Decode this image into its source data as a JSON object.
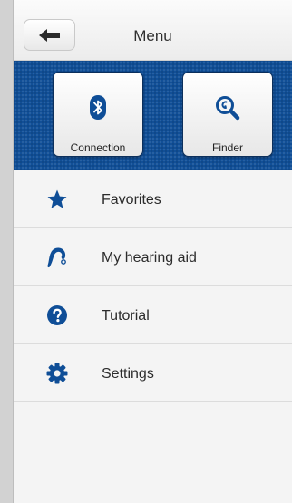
{
  "header": {
    "title": "Menu",
    "back_icon": "arrow-left-icon"
  },
  "tiles": [
    {
      "label": "Connection",
      "icon": "bluetooth-icon"
    },
    {
      "label": "Finder",
      "icon": "finder-magnifier-icon"
    }
  ],
  "menu": {
    "items": [
      {
        "label": "Favorites",
        "icon": "star-icon"
      },
      {
        "label": "My hearing aid",
        "icon": "hearing-aid-icon"
      },
      {
        "label": "Tutorial",
        "icon": "question-circle-icon"
      },
      {
        "label": "Settings",
        "icon": "gear-icon"
      }
    ]
  },
  "colors": {
    "brand_blue": "#114f97",
    "icon_blue": "#0f4e97"
  }
}
